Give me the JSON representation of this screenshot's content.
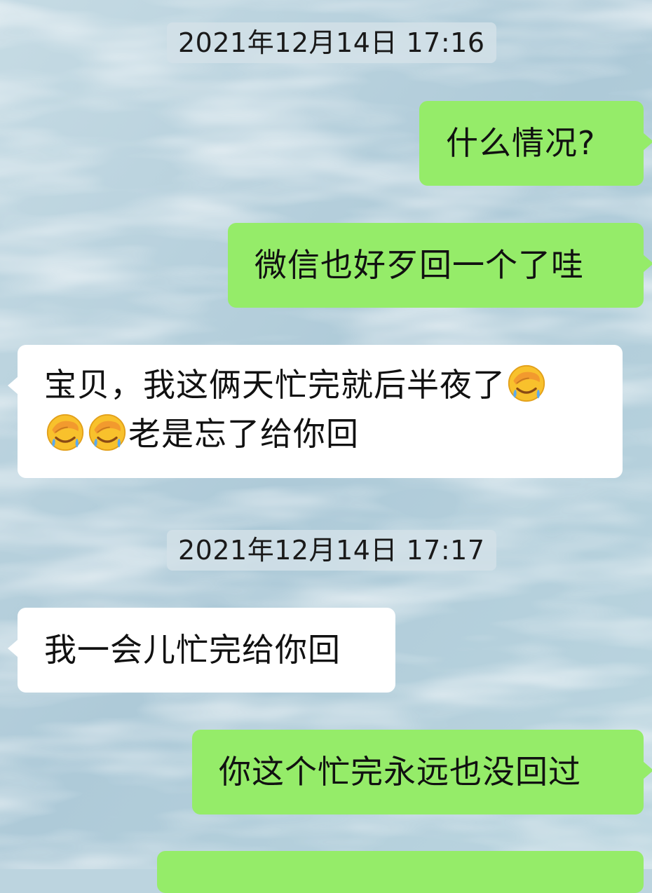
{
  "conversation": {
    "timestamps": [
      "2021年12月14日 17:16",
      "2021年12月14日 17:17"
    ],
    "messages": [
      {
        "side": "sent",
        "text": "什么情况?"
      },
      {
        "side": "sent",
        "text": "微信也好歹回一个了哇"
      },
      {
        "side": "recv",
        "line1": "宝贝，我这俩天忙完就后半夜了",
        "line2": "老是忘了给你回",
        "emoji": "face-palm-crying-emoji"
      },
      {
        "side": "recv",
        "text": "我一会儿忙完给你回"
      },
      {
        "side": "sent",
        "text": "你这个忙完永远也没回过"
      }
    ]
  },
  "colors": {
    "sent_bubble": "#95ec69",
    "received_bubble": "#ffffff",
    "timestamp_bg": "#d2e1e8",
    "background": "#bcd4df"
  }
}
